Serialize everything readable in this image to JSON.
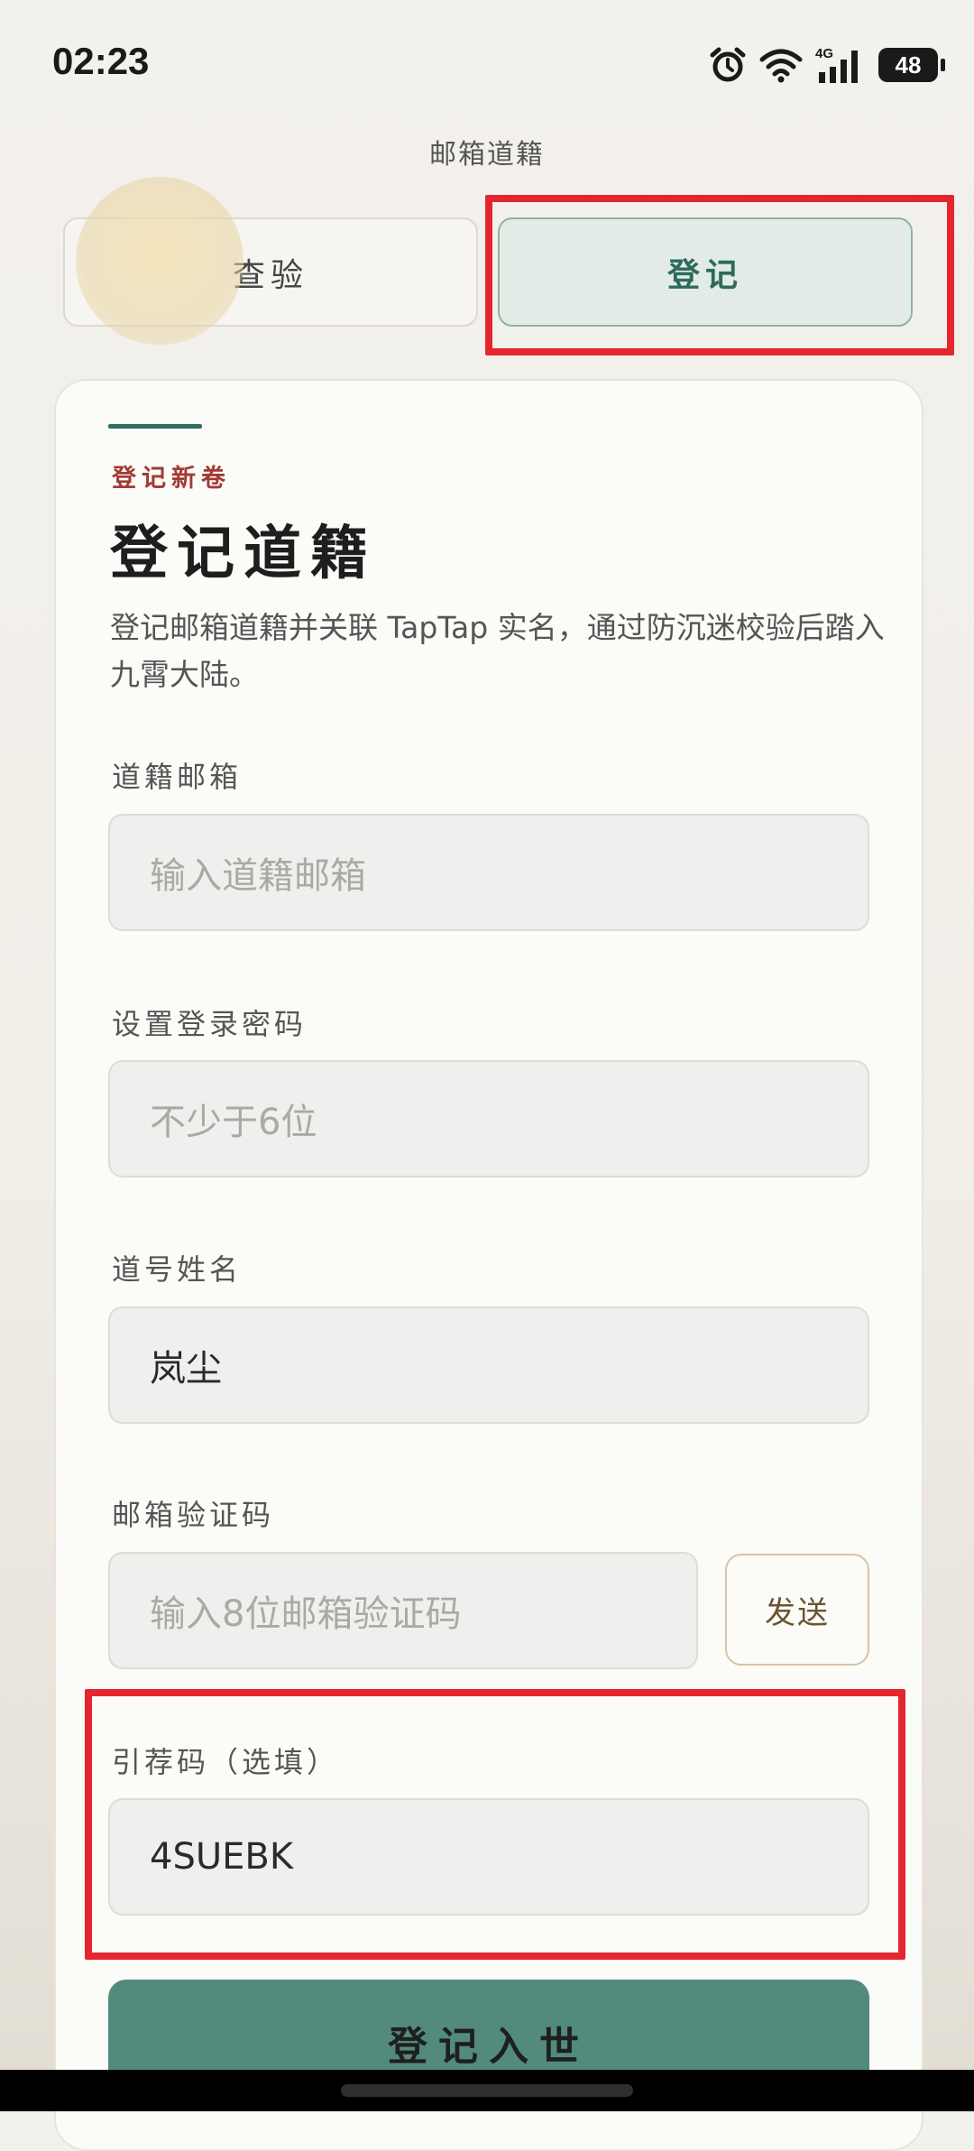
{
  "status_bar": {
    "time": "02:23",
    "network": "4G",
    "battery": "48",
    "icons": [
      "alarm-icon",
      "wifi-icon",
      "signal-icon",
      "battery-icon"
    ]
  },
  "page": {
    "heading": "邮箱道籍"
  },
  "tabs": [
    {
      "label": "查验",
      "active": false
    },
    {
      "label": "登记",
      "active": true
    }
  ],
  "form": {
    "eyebrow": "登记新卷",
    "title": "登记道籍",
    "description": "登记邮箱道籍并关联 TapTap 实名，通过防沉迷校验后踏入九霄大陆。",
    "email": {
      "label": "道籍邮箱",
      "placeholder": "输入道籍邮箱",
      "value": ""
    },
    "password": {
      "label": "设置登录密码",
      "placeholder": "不少于6位",
      "value": ""
    },
    "name": {
      "label": "道号姓名",
      "value": "岚尘"
    },
    "code": {
      "label": "邮箱验证码",
      "placeholder": "输入8位邮箱验证码",
      "value": "",
      "send_label": "发送"
    },
    "referral": {
      "label": "引荐码（选填）",
      "value": "4SUEBK"
    },
    "submit_label": "登记入世"
  },
  "colors": {
    "accent": "#2f6f64",
    "button": "#528b7d",
    "eyebrow": "#a13b34",
    "highlight": "#e52530"
  }
}
